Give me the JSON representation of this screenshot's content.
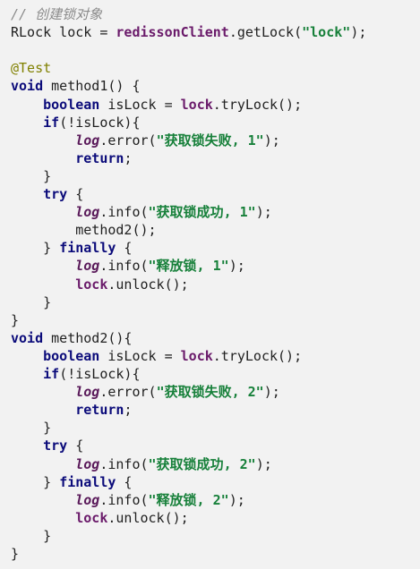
{
  "lines": [
    {
      "t": [
        [
          "cm",
          "// 创建锁对象"
        ]
      ]
    },
    {
      "t": [
        [
          "",
          "RLock lock = "
        ],
        [
          "var",
          "redissonClient"
        ],
        [
          "",
          ".getLock("
        ],
        [
          "str",
          "\"lock\""
        ],
        [
          "",
          ");"
        ]
      ]
    },
    {
      "t": []
    },
    {
      "t": [
        [
          "anno",
          "@Test"
        ]
      ]
    },
    {
      "t": [
        [
          "kw",
          "void"
        ],
        [
          "",
          " method1() {"
        ]
      ]
    },
    {
      "t": [
        [
          "",
          "    "
        ],
        [
          "kw",
          "boolean"
        ],
        [
          "",
          " isLock = "
        ],
        [
          "var",
          "lock"
        ],
        [
          "",
          ".tryLock();"
        ]
      ]
    },
    {
      "t": [
        [
          "",
          "    "
        ],
        [
          "kw",
          "if"
        ],
        [
          "",
          "(!isLock){"
        ]
      ]
    },
    {
      "t": [
        [
          "",
          "        "
        ],
        [
          "log",
          "log"
        ],
        [
          "",
          ".error("
        ],
        [
          "str",
          "\"获取锁失败, 1\""
        ],
        [
          "",
          ");"
        ]
      ]
    },
    {
      "t": [
        [
          "",
          "        "
        ],
        [
          "kw",
          "return"
        ],
        [
          "",
          ";"
        ]
      ]
    },
    {
      "t": [
        [
          "",
          "    }"
        ]
      ]
    },
    {
      "t": [
        [
          "",
          "    "
        ],
        [
          "kw",
          "try"
        ],
        [
          "",
          " {"
        ]
      ]
    },
    {
      "t": [
        [
          "",
          "        "
        ],
        [
          "log",
          "log"
        ],
        [
          "",
          ".info("
        ],
        [
          "str",
          "\"获取锁成功, 1\""
        ],
        [
          "",
          ");"
        ]
      ]
    },
    {
      "t": [
        [
          "",
          "        method2();"
        ]
      ]
    },
    {
      "t": [
        [
          "",
          "    } "
        ],
        [
          "kw",
          "finally"
        ],
        [
          "",
          " {"
        ]
      ]
    },
    {
      "t": [
        [
          "",
          "        "
        ],
        [
          "log",
          "log"
        ],
        [
          "",
          ".info("
        ],
        [
          "str",
          "\"释放锁, 1\""
        ],
        [
          "",
          ");"
        ]
      ]
    },
    {
      "t": [
        [
          "",
          "        "
        ],
        [
          "var",
          "lock"
        ],
        [
          "",
          ".unlock();"
        ]
      ]
    },
    {
      "t": [
        [
          "",
          "    }"
        ]
      ]
    },
    {
      "t": [
        [
          "",
          "}"
        ]
      ]
    },
    {
      "t": [
        [
          "kw",
          "void"
        ],
        [
          "",
          " method2(){"
        ]
      ]
    },
    {
      "t": [
        [
          "",
          "    "
        ],
        [
          "kw",
          "boolean"
        ],
        [
          "",
          " isLock = "
        ],
        [
          "var",
          "lock"
        ],
        [
          "",
          ".tryLock();"
        ]
      ]
    },
    {
      "t": [
        [
          "",
          "    "
        ],
        [
          "kw",
          "if"
        ],
        [
          "",
          "(!isLock){"
        ]
      ]
    },
    {
      "t": [
        [
          "",
          "        "
        ],
        [
          "log",
          "log"
        ],
        [
          "",
          ".error("
        ],
        [
          "str",
          "\"获取锁失败, 2\""
        ],
        [
          "",
          ");"
        ]
      ]
    },
    {
      "t": [
        [
          "",
          "        "
        ],
        [
          "kw",
          "return"
        ],
        [
          "",
          ";"
        ]
      ]
    },
    {
      "t": [
        [
          "",
          "    }"
        ]
      ]
    },
    {
      "t": [
        [
          "",
          "    "
        ],
        [
          "kw",
          "try"
        ],
        [
          "",
          " {"
        ]
      ]
    },
    {
      "t": [
        [
          "",
          "        "
        ],
        [
          "log",
          "log"
        ],
        [
          "",
          ".info("
        ],
        [
          "str",
          "\"获取锁成功, 2\""
        ],
        [
          "",
          ");"
        ]
      ]
    },
    {
      "t": [
        [
          "",
          "    } "
        ],
        [
          "kw",
          "finally"
        ],
        [
          "",
          " {"
        ]
      ]
    },
    {
      "t": [
        [
          "",
          "        "
        ],
        [
          "log",
          "log"
        ],
        [
          "",
          ".info("
        ],
        [
          "str",
          "\"释放锁, 2\""
        ],
        [
          "",
          ");"
        ]
      ]
    },
    {
      "t": [
        [
          "",
          "        "
        ],
        [
          "var",
          "lock"
        ],
        [
          "",
          ".unlock();"
        ]
      ]
    },
    {
      "t": [
        [
          "",
          "    }"
        ]
      ]
    },
    {
      "t": [
        [
          "",
          "}"
        ]
      ]
    }
  ]
}
